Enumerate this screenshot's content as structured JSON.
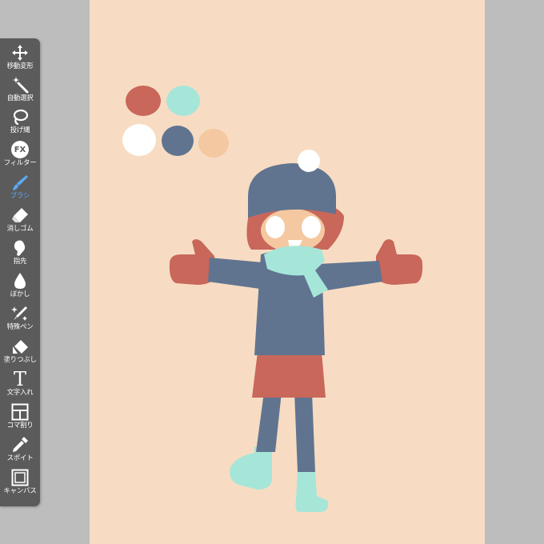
{
  "app": {
    "accent_color": "#5aa9f5"
  },
  "toolbar": {
    "tools": [
      {
        "label": "移動変形",
        "icon": "move-transform-icon"
      },
      {
        "label": "自動選択",
        "icon": "magic-wand-icon"
      },
      {
        "label": "投げ縄",
        "icon": "lasso-icon"
      },
      {
        "label": "フィルター",
        "icon": "filter-fx-icon"
      },
      {
        "label": "ブラシ",
        "icon": "brush-icon",
        "active": true
      },
      {
        "label": "消しゴム",
        "icon": "eraser-icon"
      },
      {
        "label": "指先",
        "icon": "finger-smudge-icon"
      },
      {
        "label": "ぼかし",
        "icon": "blur-drop-icon"
      },
      {
        "label": "特殊ペン",
        "icon": "special-pen-icon"
      },
      {
        "label": "塗りつぶし",
        "icon": "fill-bucket-icon"
      },
      {
        "label": "文字入れ",
        "icon": "text-icon"
      },
      {
        "label": "コマ割り",
        "icon": "panel-divide-icon"
      },
      {
        "label": "スポイト",
        "icon": "eyedropper-icon"
      },
      {
        "label": "キャンバス",
        "icon": "canvas-icon"
      }
    ],
    "fx_text": "FX",
    "text_glyph": "T"
  },
  "canvas": {
    "background": "#f7dcc3",
    "palette": [
      "#c8675a",
      "#a6e6d9",
      "#ffffff",
      "#607490",
      "#f4c8a0"
    ]
  }
}
